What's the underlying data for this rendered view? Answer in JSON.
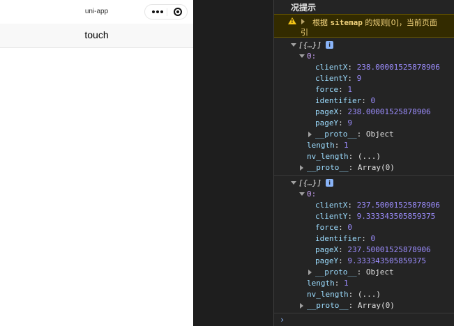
{
  "phone": {
    "app_title": "uni-app",
    "nav_title": "touch"
  },
  "console": {
    "header": "况提示",
    "warning": {
      "line1_prefix": "根据 ",
      "line1_code": "sitemap",
      "line1_suffix": " 的规则[0]，当前页面",
      "line2": "引"
    },
    "logs": [
      {
        "summary": "[{…}]",
        "index": "0:",
        "fields": [
          {
            "key": "clientX",
            "value": "238.00001525878906"
          },
          {
            "key": "clientY",
            "value": "9"
          },
          {
            "key": "force",
            "value": "1"
          },
          {
            "key": "identifier",
            "value": "0"
          },
          {
            "key": "pageX",
            "value": "238.00001525878906"
          },
          {
            "key": "pageY",
            "value": "9"
          }
        ],
        "inner_proto": {
          "key": "__proto__",
          "value": "Object"
        },
        "length": {
          "key": "length",
          "value": "1"
        },
        "nv_length": {
          "key": "nv_length",
          "value": "(...)"
        },
        "proto": {
          "key": "__proto__",
          "value": "Array(0)"
        }
      },
      {
        "summary": "[{…}]",
        "index": "0:",
        "fields": [
          {
            "key": "clientX",
            "value": "237.50001525878906"
          },
          {
            "key": "clientY",
            "value": "9.333343505859375"
          },
          {
            "key": "force",
            "value": "0"
          },
          {
            "key": "identifier",
            "value": "0"
          },
          {
            "key": "pageX",
            "value": "237.50001525878906"
          },
          {
            "key": "pageY",
            "value": "9.333343505859375"
          }
        ],
        "inner_proto": {
          "key": "__proto__",
          "value": "Object"
        },
        "length": {
          "key": "length",
          "value": "1"
        },
        "nv_length": {
          "key": "nv_length",
          "value": "(...)"
        },
        "proto": {
          "key": "__proto__",
          "value": "Array(0)"
        }
      }
    ],
    "info_badge": "i",
    "prompt_symbol": "›"
  }
}
